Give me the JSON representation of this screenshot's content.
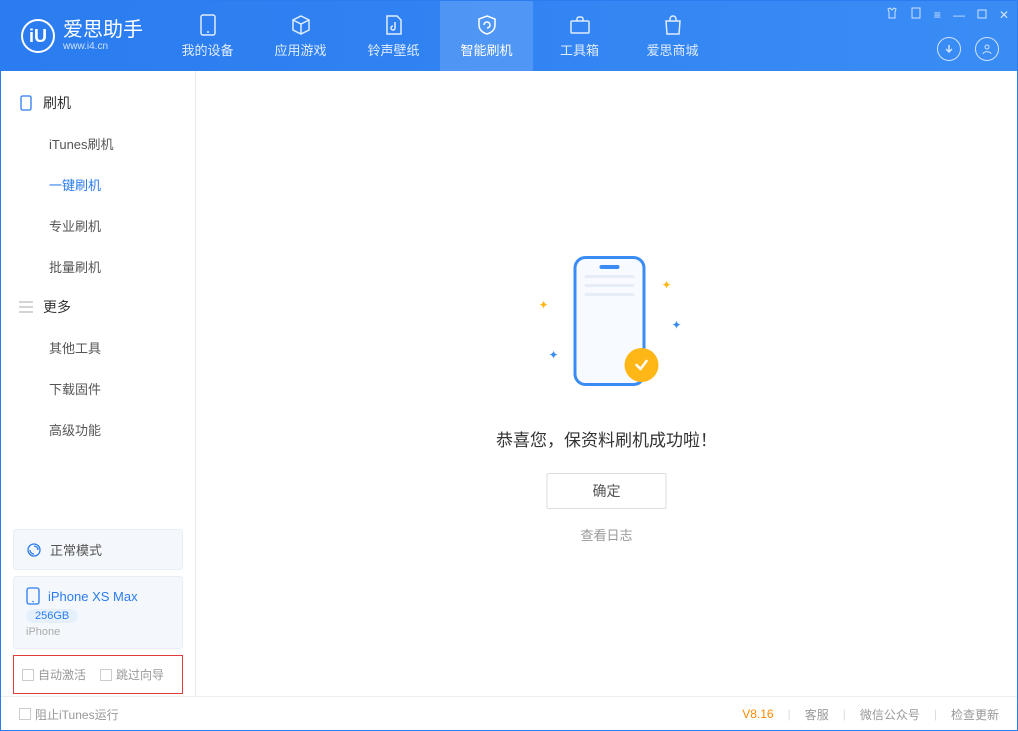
{
  "app": {
    "title": "爱思助手",
    "subtitle": "www.i4.cn"
  },
  "nav": [
    {
      "label": "我的设备"
    },
    {
      "label": "应用游戏"
    },
    {
      "label": "铃声壁纸"
    },
    {
      "label": "智能刷机"
    },
    {
      "label": "工具箱"
    },
    {
      "label": "爱思商城"
    }
  ],
  "sidebar": {
    "section1_title": "刷机",
    "section1_items": [
      "iTunes刷机",
      "一键刷机",
      "专业刷机",
      "批量刷机"
    ],
    "section2_title": "更多",
    "section2_items": [
      "其他工具",
      "下载固件",
      "高级功能"
    ]
  },
  "device": {
    "mode_label": "正常模式",
    "name": "iPhone XS Max",
    "capacity": "256GB",
    "type": "iPhone"
  },
  "options": {
    "auto_activate": "自动激活",
    "skip_guide": "跳过向导"
  },
  "main": {
    "success_msg": "恭喜您，保资料刷机成功啦！",
    "ok_label": "确定",
    "log_label": "查看日志"
  },
  "footer": {
    "block_itunes": "阻止iTunes运行",
    "version": "V8.16",
    "support": "客服",
    "wechat": "微信公众号",
    "check_update": "检查更新"
  }
}
